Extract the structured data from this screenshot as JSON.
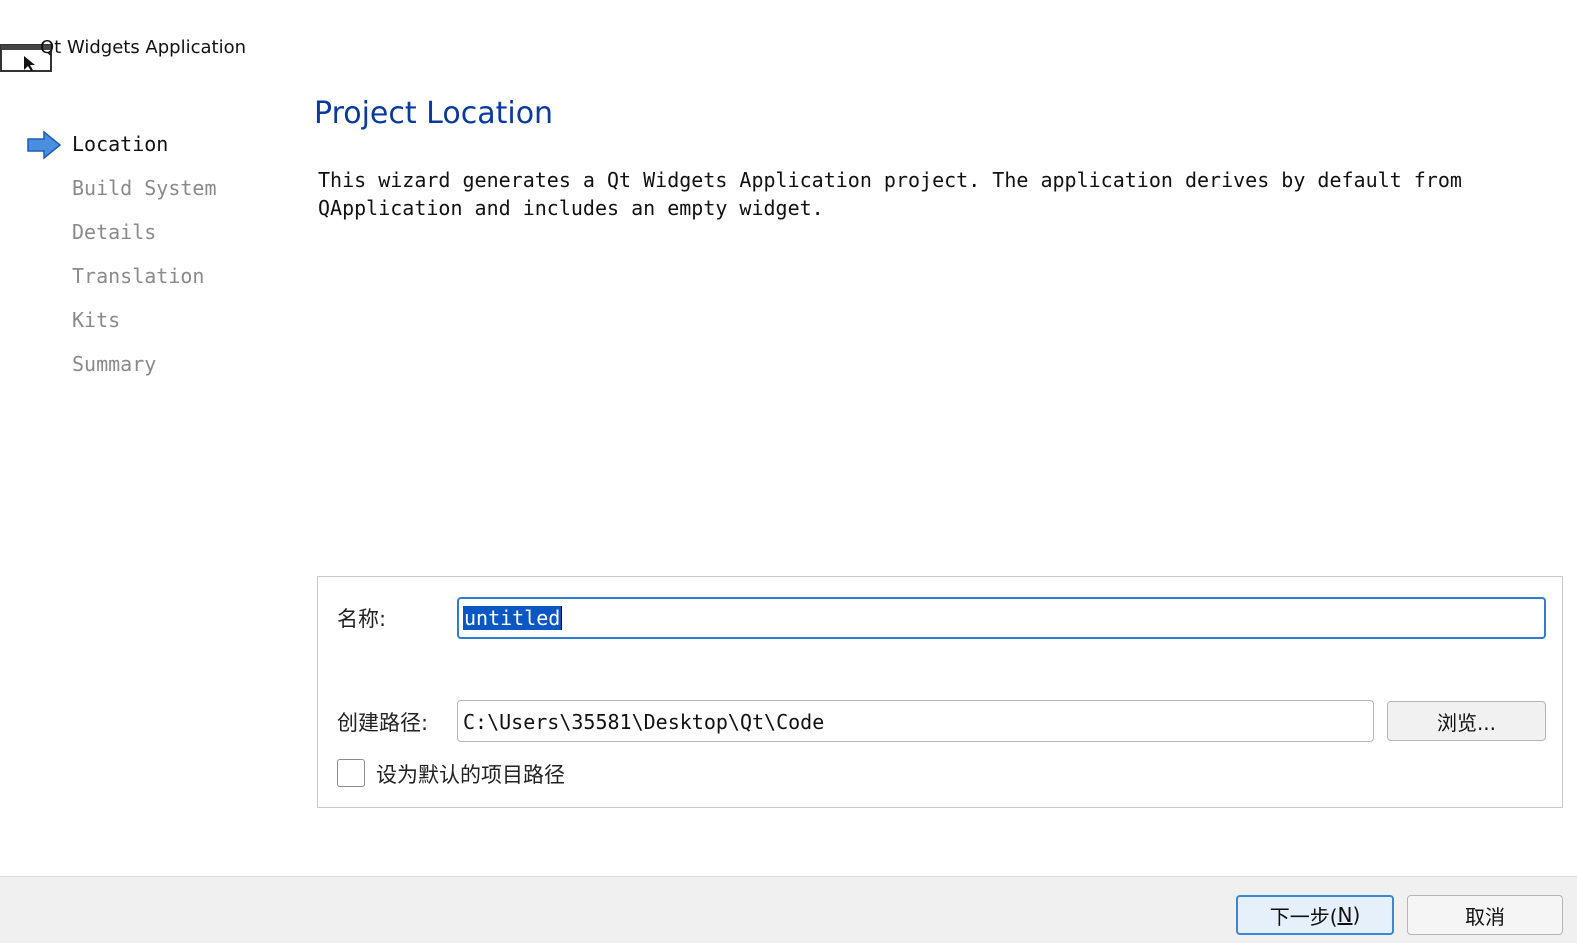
{
  "window": {
    "title": "Qt Widgets Application"
  },
  "steps": [
    {
      "label": "Location",
      "current": true
    },
    {
      "label": "Build System",
      "current": false
    },
    {
      "label": "Details",
      "current": false
    },
    {
      "label": "Translation",
      "current": false
    },
    {
      "label": "Kits",
      "current": false
    },
    {
      "label": "Summary",
      "current": false
    }
  ],
  "page": {
    "title": "Project Location",
    "intro_line1": "This wizard generates a Qt Widgets Application project. The application derives by default from",
    "intro_line2": "QApplication and includes an empty widget."
  },
  "form": {
    "name_label": "名称:",
    "name_value": "untitled",
    "path_label": "创建路径:",
    "path_value": "C:\\Users\\35581\\Desktop\\Qt\\Code",
    "browse_label": "浏览...",
    "default_path_label": "设为默认的项目路径",
    "default_path_checked": false
  },
  "buttons": {
    "next_prefix": "下一步(",
    "next_mnemonic": "N",
    "next_suffix": ")",
    "cancel_label": "取消"
  },
  "colors": {
    "title_blue": "#0a3a9c",
    "selection": "#0a57c4",
    "focus_border": "#2f7bd6",
    "step_inactive": "#8a8a8a"
  },
  "icons": [
    "qt-app-window-icon",
    "current-step-arrow-icon"
  ]
}
